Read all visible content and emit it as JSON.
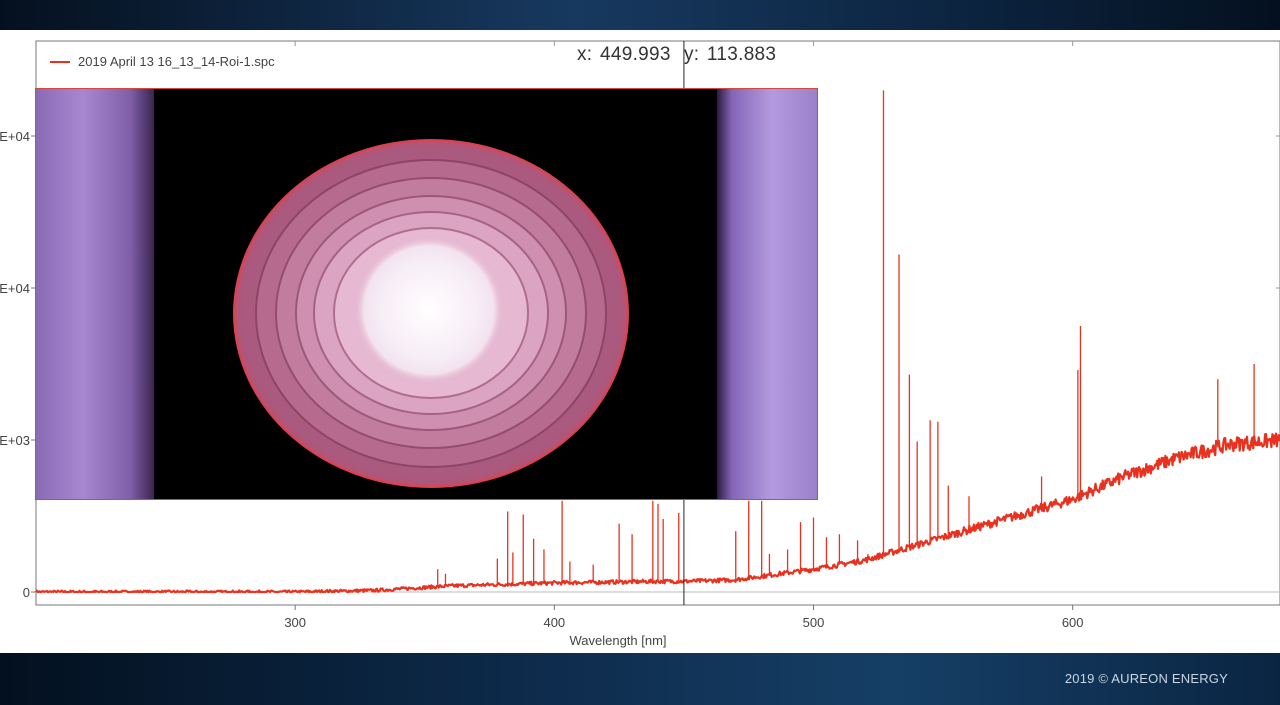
{
  "footer": {
    "copyright": "2019 © AUREON ENERGY"
  },
  "legend": {
    "label": "2019 April 13 16_13_14-Roi-1.spc",
    "color": "#e8321f"
  },
  "cursor_readout": {
    "x_label": "x:",
    "x_value": "449.993",
    "y_label": "y:",
    "y_value": "113.883"
  },
  "colors": {
    "series": "#e8321f",
    "grid": "#d8d8d8",
    "axis": "#666666",
    "inset_border": "#d24a3a"
  },
  "inset_image": {
    "description_icon": "plasma-image"
  },
  "chart_data": {
    "type": "line",
    "title": "",
    "xlabel": "Wavelength [nm]",
    "ylabel": "",
    "xlim": [
      200,
      680
    ],
    "ylim": [
      0,
      30000
    ],
    "x_ticks": [
      300,
      400,
      500,
      600
    ],
    "y_tick_labels": [
      "0",
      "E+03",
      "E+04",
      "E+04"
    ],
    "y_tick_values": [
      0,
      10000,
      20000,
      30000
    ],
    "cursor_x": 450,
    "series": [
      {
        "name": "2019 April 13 16_13_14-Roi-1.spc",
        "baseline": [
          [
            200,
            0
          ],
          [
            300,
            0
          ],
          [
            330,
            100
          ],
          [
            360,
            400
          ],
          [
            400,
            600
          ],
          [
            440,
            700
          ],
          [
            450,
            700
          ],
          [
            470,
            800
          ],
          [
            500,
            1500
          ],
          [
            520,
            2100
          ],
          [
            550,
            3600
          ],
          [
            580,
            5100
          ],
          [
            600,
            6100
          ],
          [
            620,
            7600
          ],
          [
            640,
            8800
          ],
          [
            660,
            9700
          ],
          [
            680,
            10000
          ]
        ],
        "peaks": [
          [
            355,
            1500
          ],
          [
            358,
            1200
          ],
          [
            378,
            2200
          ],
          [
            382,
            5300
          ],
          [
            384,
            2600
          ],
          [
            388,
            5100
          ],
          [
            392,
            3500
          ],
          [
            396,
            2800
          ],
          [
            403,
            6000
          ],
          [
            406,
            2000
          ],
          [
            415,
            1800
          ],
          [
            425,
            4500
          ],
          [
            430,
            3800
          ],
          [
            438,
            6000
          ],
          [
            440,
            5800
          ],
          [
            442,
            4800
          ],
          [
            448,
            5200
          ],
          [
            470,
            4000
          ],
          [
            475,
            6000
          ],
          [
            480,
            6000
          ],
          [
            483,
            2500
          ],
          [
            490,
            2800
          ],
          [
            495,
            4600
          ],
          [
            500,
            4900
          ],
          [
            505,
            3600
          ],
          [
            510,
            3800
          ],
          [
            517,
            3400
          ],
          [
            521,
            2500
          ],
          [
            527,
            33000
          ],
          [
            533,
            22200
          ],
          [
            537,
            14300
          ],
          [
            540,
            9900
          ],
          [
            545,
            11300
          ],
          [
            548,
            11200
          ],
          [
            552,
            7000
          ],
          [
            560,
            6300
          ],
          [
            588,
            7600
          ],
          [
            602,
            14600
          ],
          [
            603,
            17500
          ],
          [
            656,
            14000
          ],
          [
            670,
            15000
          ]
        ]
      }
    ]
  }
}
